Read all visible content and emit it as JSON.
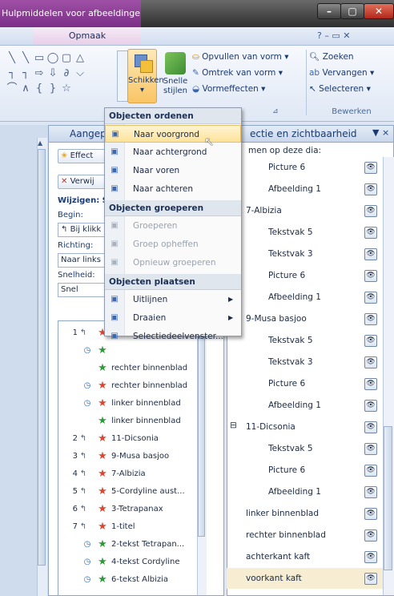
{
  "window": {
    "context_title": "Hulpmiddelen voor afbeeldingen",
    "controls": {
      "minimize": "–",
      "maximize": "▢",
      "close": "✕"
    }
  },
  "tabs": {
    "context_tab": "Opmaak",
    "help_icons": "?  –  ▭  ✕"
  },
  "ribbon": {
    "arrange_button": "Schikken",
    "quick_styles_line1": "Snelle",
    "quick_styles_line2": "stijlen",
    "shape_fill": "Opvullen van vorm",
    "shape_outline": "Omtrek van vorm",
    "shape_effects": "Vormeffecten",
    "find": "Zoeken",
    "replace": "Vervangen",
    "select": "Selecteren",
    "edit_group_title": "Bewerken"
  },
  "custom_anim_pane": {
    "title": "Aangepast",
    "effect_button": "Effect",
    "remove_button": "Verwij",
    "modify_label": "Wijzigen: S",
    "start_label": "Begin:",
    "start_value": "Bij klikk",
    "direction_label": "Richting:",
    "direction_value": "Naar links",
    "speed_label": "Snelheid:",
    "speed_value": "Snel",
    "items": [
      {
        "num": "1",
        "trigger": true,
        "clock": false,
        "star": "red",
        "name": ""
      },
      {
        "num": "",
        "trigger": false,
        "clock": true,
        "star": "green",
        "name": ""
      },
      {
        "num": "",
        "trigger": false,
        "clock": false,
        "star": "green",
        "name": "rechter binnenblad"
      },
      {
        "num": "",
        "trigger": false,
        "clock": true,
        "star": "red",
        "name": "rechter binnenblad"
      },
      {
        "num": "",
        "trigger": false,
        "clock": true,
        "star": "red",
        "name": "linker binnenblad"
      },
      {
        "num": "",
        "trigger": false,
        "clock": false,
        "star": "green",
        "name": "linker binnenblad"
      },
      {
        "num": "2",
        "trigger": true,
        "clock": false,
        "star": "red",
        "name": "11-Dicsonia"
      },
      {
        "num": "3",
        "trigger": true,
        "clock": false,
        "star": "red",
        "name": "9-Musa basjoo"
      },
      {
        "num": "4",
        "trigger": true,
        "clock": false,
        "star": "red",
        "name": "7-Albizia"
      },
      {
        "num": "5",
        "trigger": true,
        "clock": false,
        "star": "red",
        "name": "5-Cordyline aust..."
      },
      {
        "num": "6",
        "trigger": true,
        "clock": false,
        "star": "red",
        "name": "3-Tetrapanax"
      },
      {
        "num": "7",
        "trigger": true,
        "clock": false,
        "star": "red",
        "name": "1-titel"
      },
      {
        "num": "",
        "trigger": false,
        "clock": true,
        "star": "green",
        "name": "2-tekst Tetrapan..."
      },
      {
        "num": "",
        "trigger": false,
        "clock": true,
        "star": "green",
        "name": "4-tekst Cordyline"
      },
      {
        "num": "",
        "trigger": false,
        "clock": true,
        "star": "green",
        "name": "6-tekst Albizia"
      }
    ]
  },
  "selection_pane": {
    "title": "ectie en zichtbaarheid",
    "subtitle": "men op deze dia:",
    "rows": [
      {
        "indent": 2,
        "label": "Picture 6",
        "group": false,
        "selected": false
      },
      {
        "indent": 2,
        "label": "Afbeelding 1",
        "group": false,
        "selected": false
      },
      {
        "indent": 1,
        "label": "7-Albizia",
        "group": true,
        "selected": false
      },
      {
        "indent": 2,
        "label": "Tekstvak 5",
        "group": false,
        "selected": false
      },
      {
        "indent": 2,
        "label": "Tekstvak 3",
        "group": false,
        "selected": false
      },
      {
        "indent": 2,
        "label": "Picture 6",
        "group": false,
        "selected": false
      },
      {
        "indent": 2,
        "label": "Afbeelding 1",
        "group": false,
        "selected": false
      },
      {
        "indent": 1,
        "label": "9-Musa basjoo",
        "group": true,
        "selected": false
      },
      {
        "indent": 2,
        "label": "Tekstvak 5",
        "group": false,
        "selected": false
      },
      {
        "indent": 2,
        "label": "Tekstvak 3",
        "group": false,
        "selected": false
      },
      {
        "indent": 2,
        "label": "Picture 6",
        "group": false,
        "selected": false
      },
      {
        "indent": 2,
        "label": "Afbeelding 1",
        "group": false,
        "selected": false
      },
      {
        "indent": 1,
        "label": "11-Dicsonia",
        "group": true,
        "selected": false,
        "expander": "⊟"
      },
      {
        "indent": 2,
        "label": "Tekstvak 5",
        "group": false,
        "selected": false
      },
      {
        "indent": 2,
        "label": "Picture 6",
        "group": false,
        "selected": false
      },
      {
        "indent": 2,
        "label": "Afbeelding 1",
        "group": false,
        "selected": false
      },
      {
        "indent": 0,
        "label": "linker binnenblad",
        "group": false,
        "selected": false
      },
      {
        "indent": 0,
        "label": "rechter binnenblad",
        "group": false,
        "selected": false
      },
      {
        "indent": 0,
        "label": "achterkant kaft",
        "group": false,
        "selected": false
      },
      {
        "indent": 0,
        "label": "voorkant kaft",
        "group": false,
        "selected": true
      }
    ]
  },
  "arrange_menu": {
    "sections": [
      {
        "header": "Objecten ordenen",
        "items": [
          {
            "label": "Naar voorgrond",
            "icon": "bring-to-front-icon",
            "disabled": false,
            "highlight": true,
            "submenu": false
          },
          {
            "label": "Naar achtergrond",
            "icon": "send-to-back-icon",
            "disabled": false,
            "highlight": false,
            "submenu": false
          },
          {
            "label": "Naar voren",
            "icon": "bring-forward-icon",
            "disabled": false,
            "highlight": false,
            "submenu": false
          },
          {
            "label": "Naar achteren",
            "icon": "send-backward-icon",
            "disabled": false,
            "highlight": false,
            "submenu": false
          }
        ]
      },
      {
        "header": "Objecten groeperen",
        "items": [
          {
            "label": "Groeperen",
            "icon": "group-icon",
            "disabled": true,
            "highlight": false,
            "submenu": false
          },
          {
            "label": "Groep opheffen",
            "icon": "ungroup-icon",
            "disabled": true,
            "highlight": false,
            "submenu": false
          },
          {
            "label": "Opnieuw groeperen",
            "icon": "regroup-icon",
            "disabled": true,
            "highlight": false,
            "submenu": false
          }
        ]
      },
      {
        "header": "Objecten plaatsen",
        "items": [
          {
            "label": "Uitlijnen",
            "icon": "align-icon",
            "disabled": false,
            "highlight": false,
            "submenu": true
          },
          {
            "label": "Draaien",
            "icon": "rotate-icon",
            "disabled": false,
            "highlight": false,
            "submenu": true
          },
          {
            "label": "Selectiedeelvenster...",
            "icon": "selection-pane-icon",
            "disabled": false,
            "highlight": false,
            "submenu": false
          }
        ]
      }
    ]
  },
  "colors": {
    "accent_highlight": "#fde39a",
    "context_tab": "#9f4fa6",
    "red_star": "#e0452f",
    "green_star": "#2e9b3a"
  }
}
